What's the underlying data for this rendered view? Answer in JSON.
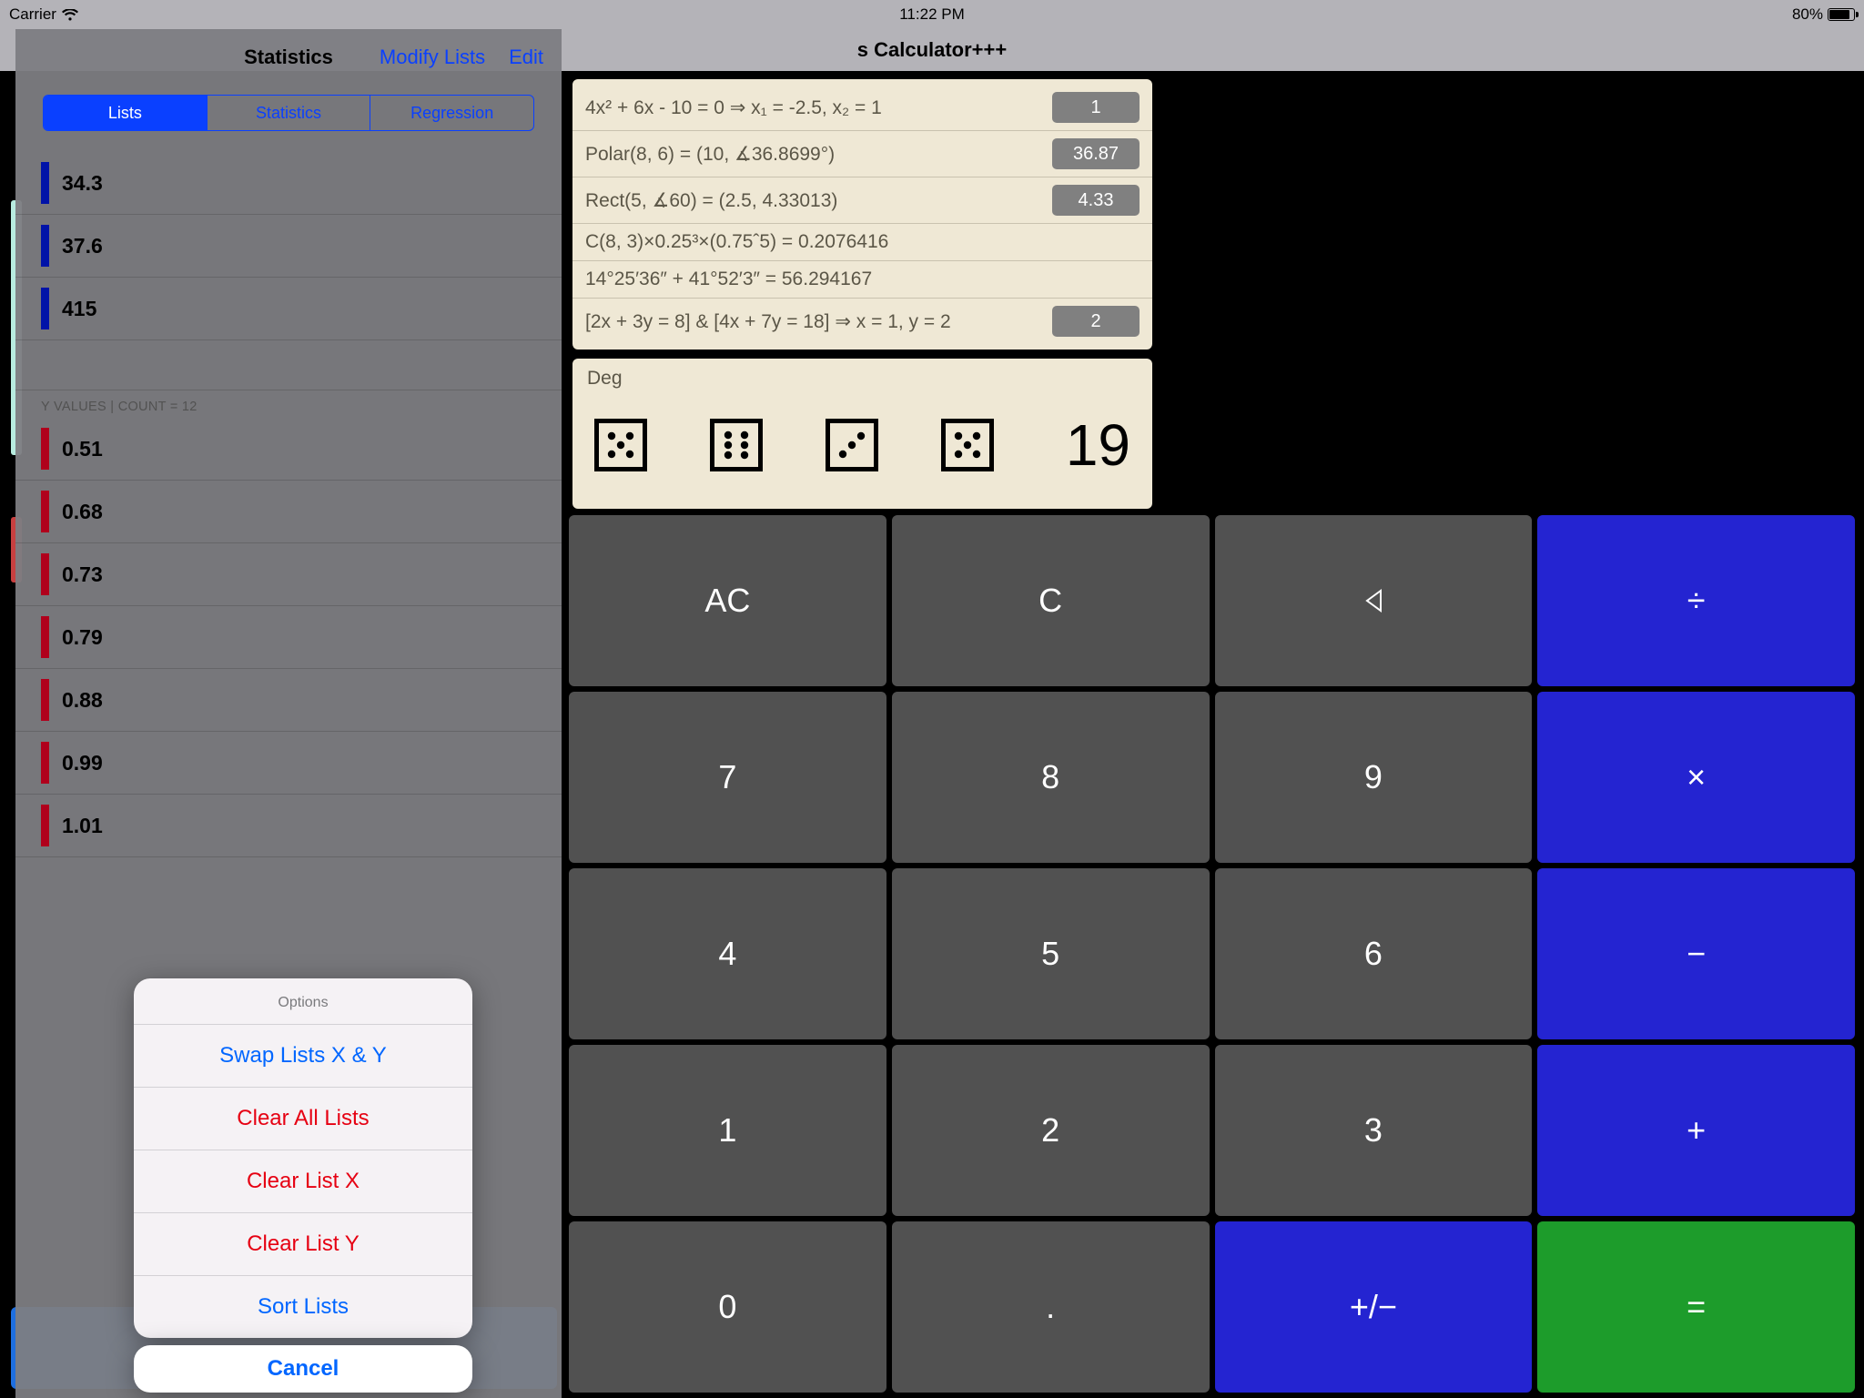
{
  "status": {
    "carrier": "Carrier",
    "time": "11:22 PM",
    "battery_pct": "80%"
  },
  "app_title": "s Calculator+++",
  "popover": {
    "title": "Statistics",
    "modify": "Modify Lists",
    "edit": "Edit",
    "seg": {
      "lists": "Lists",
      "stats": "Statistics",
      "regression": "Regression"
    },
    "x_values": [
      "34.3",
      "37.6",
      "415"
    ],
    "y_header": "Y VALUES | COUNT = 12",
    "y_values": [
      "0.51",
      "0.68",
      "0.73",
      "0.79",
      "0.88",
      "0.99",
      "1.01"
    ]
  },
  "sheet": {
    "title": "Options",
    "swap": "Swap Lists X & Y",
    "clear_all": "Clear All Lists",
    "clear_x": "Clear List X",
    "clear_y": "Clear List Y",
    "sort": "Sort Lists",
    "cancel": "Cancel"
  },
  "history": [
    {
      "expr": "4x² + 6x - 10 = 0      ⇒      x₁ = -2.5, x₂ = 1",
      "result": "1"
    },
    {
      "expr": "Polar(8, 6) = (10, ∡36.8699°)",
      "result": "36.87"
    },
    {
      "expr": "Rect(5, ∡60) = (2.5, 4.33013)",
      "result": "4.33"
    },
    {
      "expr": "C(8, 3)×0.25³×(0.75ˆ5) = 0.2076416",
      "result": ""
    },
    {
      "expr": "14°25′36″ + 41°52′3″ = 56.294167",
      "result": ""
    },
    {
      "expr": "[2x + 3y = 8]  &  [4x + 7y = 18] ⇒ x = 1, y = 2",
      "result": "2"
    }
  ],
  "display": {
    "mode": "Deg",
    "dice": [
      5,
      6,
      3,
      5
    ],
    "value": "19"
  },
  "keypad": {
    "ac": "AC",
    "c": "C",
    "div": "÷",
    "mul": "×",
    "sub": "−",
    "add": "+",
    "eq": "=",
    "d7": "7",
    "d8": "8",
    "d9": "9",
    "d4": "4",
    "d5": "5",
    "d6": "6",
    "d1": "1",
    "d2": "2",
    "d3": "3",
    "d0": "0",
    "dot": ".",
    "pm": "+/−"
  }
}
